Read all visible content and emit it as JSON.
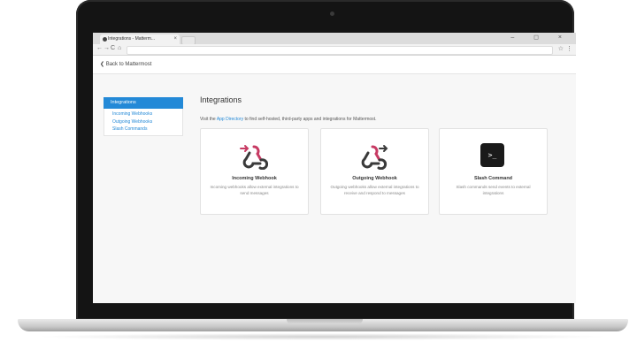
{
  "browser": {
    "tab_title": "Integrations - Matterm...",
    "tab_close": "×",
    "window_controls": "– ◻ ×",
    "nav_back": "←",
    "nav_forward": "→",
    "nav_reload": "C",
    "nav_home": "⌂",
    "star": "☆",
    "menu": "⋮"
  },
  "page": {
    "back_link": "❮ Back to Mattermost",
    "sidebar": {
      "active_label": "Integrations",
      "items": [
        {
          "label": "Incoming Webhooks"
        },
        {
          "label": "Outgoing Webhooks"
        },
        {
          "label": "Slash Commands"
        }
      ]
    },
    "title": "Integrations",
    "intro_prefix": "Visit the ",
    "intro_link": "App Directory",
    "intro_suffix": " to find self-hosted, third-party apps and integrations for Mattermost.",
    "cards": [
      {
        "title": "Incoming Webhook",
        "description": "Incoming webhooks allow external integrations to send messages",
        "icon": "webhook-incoming-icon"
      },
      {
        "title": "Outgoing Webhook",
        "description": "Outgoing webhooks allow external integrations to receive and respond to messages",
        "icon": "webhook-outgoing-icon"
      },
      {
        "title": "Slash Command",
        "description": "Slash commands send events to external integrations",
        "icon": "terminal-icon",
        "glyph": ">_"
      }
    ]
  },
  "colors": {
    "accent": "#2389d7",
    "webhook": "#c73a63"
  }
}
